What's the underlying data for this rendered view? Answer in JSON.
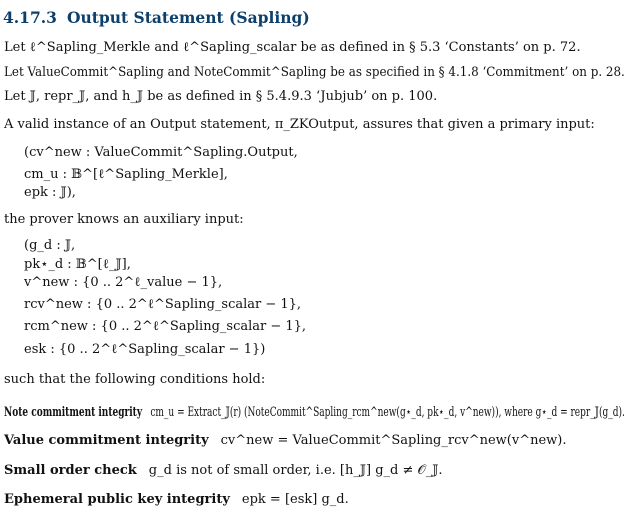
{
  "section": {
    "number": "4.17.3",
    "title": "Output Statement (Sapling)"
  },
  "lines": [
    "Let ℓ^Sapling_Merkle and ℓ^Sapling_scalar be as defined in § 5.3 ‘Constants’ on p. 72.",
    "Let ValueCommit^Sapling and NoteCommit^Sapling be as specified in § 4.1.8 ‘Commitment’ on p. 28.",
    "Let 𝕁, repr_𝕁, and h_𝕁 be as defined in § 5.4.9.3 ‘Jubjub’ on p. 100.",
    "A valid instance of an Output statement, π_ZKOutput, assures that given a primary input:",
    "(cv^new : ValueCommit^Sapling.Output,",
    "cm_u : 𝔹^[ℓ^Sapling_Merkle],",
    "epk : 𝕁),",
    "the prover knows an auxiliary input:",
    "(g_d : 𝕁,",
    "pk⋆_d : 𝔹^[ℓ_𝕁],",
    "v^new : {0 .. 2^ℓ_value − 1},",
    "rcv^new : {0 .. 2^ℓ^Sapling_scalar − 1},",
    "rcm^new : {0 .. 2^ℓ^Sapling_scalar − 1},",
    "esk : {0 .. 2^ℓ^Sapling_scalar − 1})",
    "such that the following conditions hold:"
  ],
  "conditions": [
    {
      "label": "Note commitment integrity",
      "text": "cm_u = Extract_𝕁(r) (NoteCommit^Sapling_rcm^new(g⋆_d, pk⋆_d, v^new)), where g⋆_d = repr_𝕁(g_d)."
    },
    {
      "label": "Value commitment integrity",
      "text": "cv^new = ValueCommit^Sapling_rcv^new(v^new)."
    },
    {
      "label": "Small order check",
      "text": "g_d is not of small order, i.e. [h_𝕁] g_d ≠ 𝒪_𝕁."
    },
    {
      "label": "Ephemeral public key integrity",
      "text": "epk = [esk] g_d."
    }
  ],
  "colors": {
    "heading": "#0c3f6b",
    "text": "#111111",
    "background": "#ffffff"
  }
}
